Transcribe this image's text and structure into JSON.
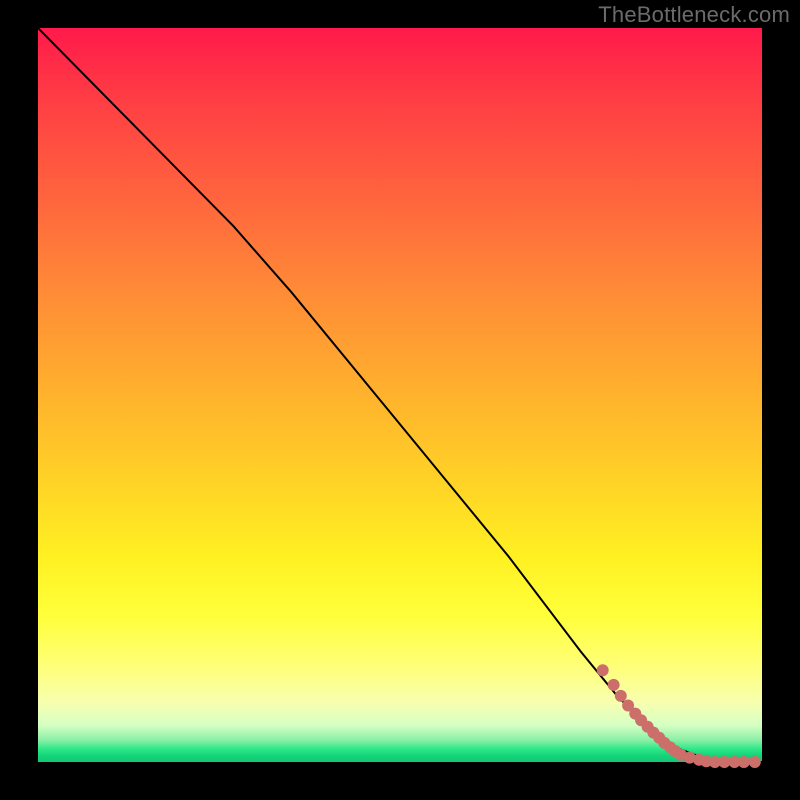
{
  "watermark": "TheBottleneck.com",
  "colors": {
    "background": "#000000",
    "curve": "#000000",
    "dot": "#cc6f6a",
    "gradient_top": "#ff1a4a",
    "gradient_bottom": "#0fc873"
  },
  "chart_data": {
    "type": "line",
    "title": "",
    "xlabel": "",
    "ylabel": "",
    "xlim": [
      0,
      100
    ],
    "ylim": [
      0,
      100
    ],
    "series": [
      {
        "name": "bottleneck-curve",
        "x": [
          0,
          10,
          20,
          27,
          35,
          45,
          55,
          65,
          75,
          80,
          84,
          88,
          92,
          95,
          100
        ],
        "y": [
          100,
          90,
          80,
          73,
          64,
          52,
          40,
          28,
          15,
          9,
          5,
          2,
          0.5,
          0,
          0
        ]
      }
    ],
    "scatter": {
      "name": "highlight-points",
      "points": [
        {
          "x": 78.0,
          "y": 12.5
        },
        {
          "x": 79.5,
          "y": 10.5
        },
        {
          "x": 80.5,
          "y": 9.0
        },
        {
          "x": 81.5,
          "y": 7.7
        },
        {
          "x": 82.5,
          "y": 6.6
        },
        {
          "x": 83.3,
          "y": 5.7
        },
        {
          "x": 84.2,
          "y": 4.8
        },
        {
          "x": 85.0,
          "y": 4.0
        },
        {
          "x": 85.8,
          "y": 3.3
        },
        {
          "x": 86.5,
          "y": 2.6
        },
        {
          "x": 87.3,
          "y": 2.0
        },
        {
          "x": 88.0,
          "y": 1.5
        },
        {
          "x": 88.8,
          "y": 1.0
        },
        {
          "x": 90.0,
          "y": 0.6
        },
        {
          "x": 91.3,
          "y": 0.3
        },
        {
          "x": 92.3,
          "y": 0.1
        },
        {
          "x": 93.5,
          "y": 0.0
        },
        {
          "x": 94.8,
          "y": 0.0
        },
        {
          "x": 96.2,
          "y": 0.0
        },
        {
          "x": 97.5,
          "y": 0.0
        },
        {
          "x": 99.0,
          "y": 0.0
        }
      ]
    }
  }
}
